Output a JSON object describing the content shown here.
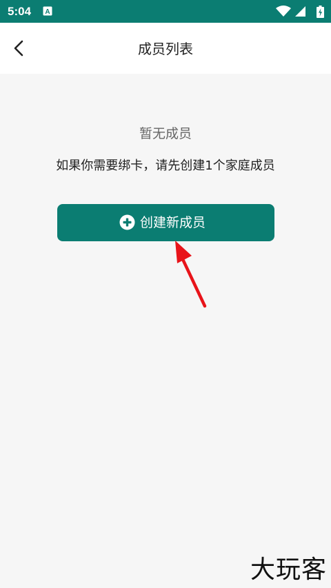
{
  "status_bar": {
    "time": "5:04",
    "app_icon": "A",
    "icons": [
      "wifi-icon",
      "cell-signal-icon",
      "battery-charging-icon"
    ],
    "background": "#0b7d72"
  },
  "header": {
    "back_icon": "chevron-left-icon",
    "title": "成员列表"
  },
  "empty_state": {
    "title": "暂无成员",
    "hint": "如果你需要绑卡，请先创建1个家庭成员"
  },
  "create_button": {
    "icon": "plus-circle-icon",
    "label": "创建新成员",
    "color": "#0b7d72"
  },
  "annotation": {
    "type": "red-arrow",
    "color": "#e8141a"
  },
  "watermark": {
    "text": "大玩客"
  }
}
